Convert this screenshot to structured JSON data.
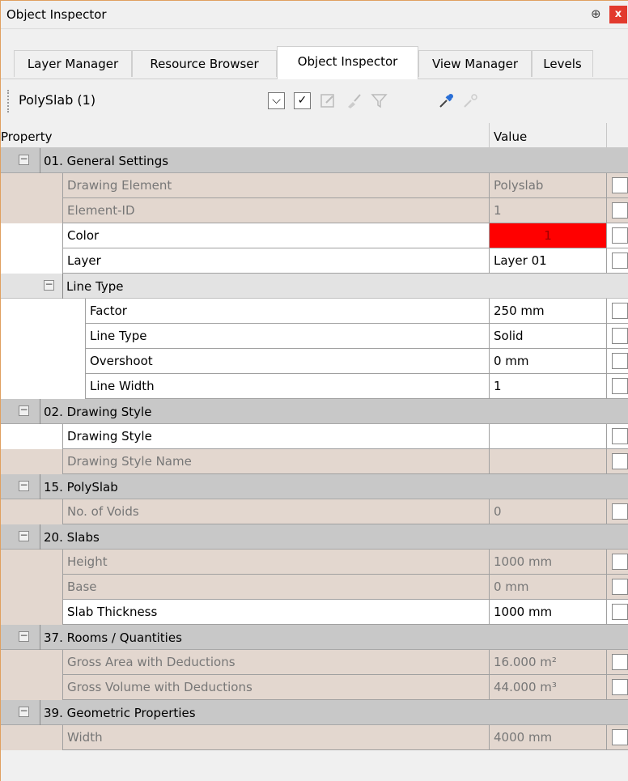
{
  "window": {
    "title": "Object Inspector",
    "pin_icon": "pin-icon",
    "close_label": "x"
  },
  "tabs": [
    {
      "label": "Layer Manager",
      "active": false
    },
    {
      "label": "Resource Browser",
      "active": false
    },
    {
      "label": "Object Inspector",
      "active": true
    },
    {
      "label": "View Manager",
      "active": false
    },
    {
      "label": "Levels",
      "active": false
    }
  ],
  "toolbar": {
    "selection": "PolySlab (1)",
    "dropdown_glyph": "⌵",
    "check_glyph": "✓"
  },
  "grid": {
    "header": {
      "property": "Property",
      "value": "Value"
    },
    "categories": {
      "general": "01. General Settings",
      "linetype": "Line Type",
      "drawingstyle": "02. Drawing Style",
      "polyslab": "15. PolySlab",
      "slabs": "20. Slabs",
      "rooms": "37. Rooms / Quantities",
      "geometric": "39. Geometric Properties"
    },
    "rows": {
      "drawing_element": {
        "name": "Drawing Element",
        "value": "Polyslab"
      },
      "element_id": {
        "name": "Element-ID",
        "value": "1"
      },
      "color": {
        "name": "Color",
        "value": "1",
        "swatch": "#ff0000"
      },
      "layer": {
        "name": "Layer",
        "value": "Layer 01"
      },
      "factor": {
        "name": "Factor",
        "value": "250 mm"
      },
      "line_type": {
        "name": "Line Type",
        "value": "Solid"
      },
      "overshoot": {
        "name": "Overshoot",
        "value": "0 mm"
      },
      "line_width": {
        "name": "Line Width",
        "value": "1"
      },
      "drawing_style": {
        "name": "Drawing Style",
        "value": ""
      },
      "drawing_style_name": {
        "name": "Drawing Style Name",
        "value": ""
      },
      "no_of_voids": {
        "name": "No. of Voids",
        "value": "0"
      },
      "height": {
        "name": "Height",
        "value": "1000 mm"
      },
      "base": {
        "name": "Base",
        "value": "0 mm"
      },
      "slab_thickness": {
        "name": "Slab Thickness",
        "value": "1000 mm"
      },
      "gross_area": {
        "name": "Gross Area with Deductions",
        "value": "16.000 m²"
      },
      "gross_volume": {
        "name": "Gross Volume with Deductions",
        "value": "44.000 m³"
      },
      "width": {
        "name": "Width",
        "value": "4000 mm"
      }
    }
  },
  "colors": {
    "readonly_bg": "#e3d7cf",
    "category_bg": "#c8c8c8",
    "color_swatch": "#ff0000"
  }
}
